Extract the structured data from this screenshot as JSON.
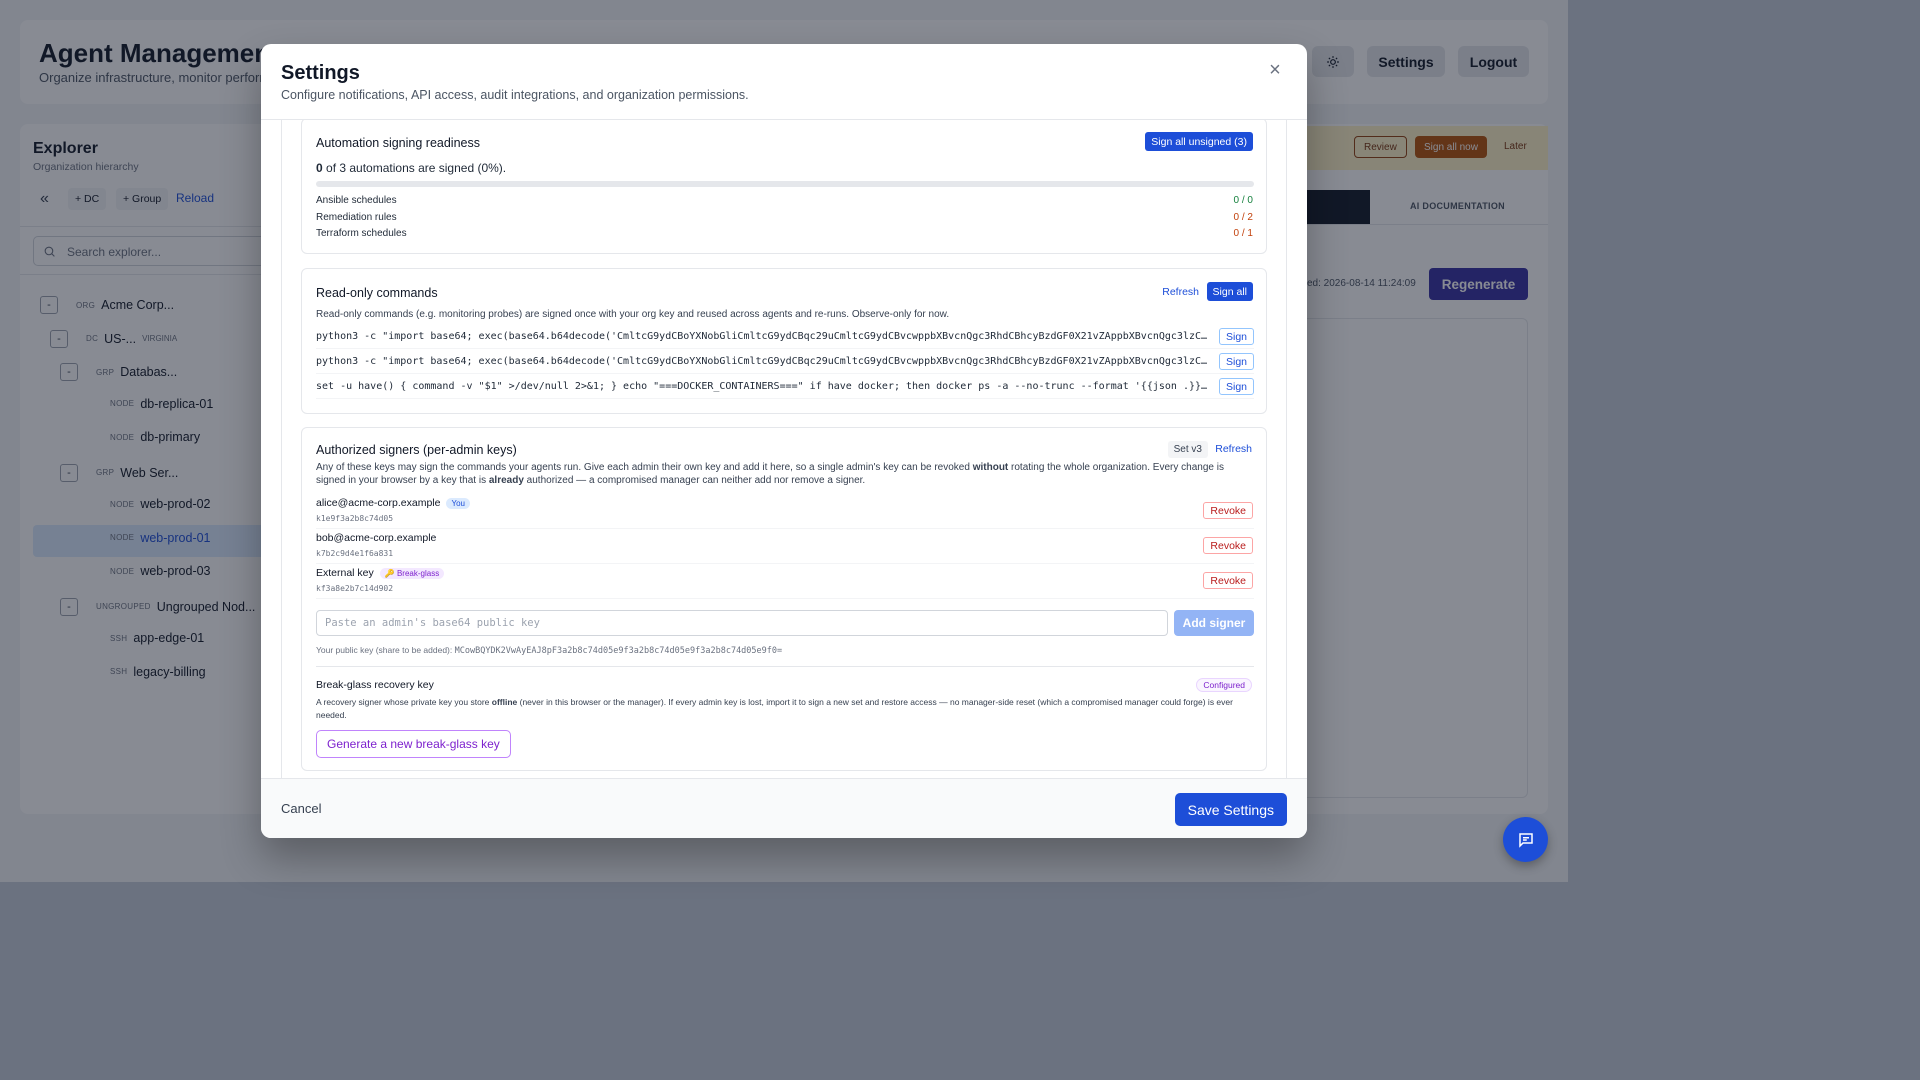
{
  "background": {
    "title": "Agent Managemen",
    "subtitle": "Organize infrastructure, monitor performa",
    "header_buttons": {
      "theme_icon": "sun-icon",
      "settings": "Settings",
      "logout": "Logout"
    },
    "explorer": {
      "title": "Explorer",
      "subtitle": "Organization hierarchy",
      "toolbar": {
        "collapse_icon": "double-chevron-left-icon",
        "add_dc": "+ DC",
        "add_group": "+ Group",
        "reload": "Reload"
      },
      "search_placeholder": "Search explorer...",
      "tree": [
        {
          "toggle": "-",
          "type": "ORG",
          "label": "Acme Corp...",
          "sub": ""
        },
        {
          "toggle": "-",
          "type": "DC",
          "label": "US-...",
          "sub": "VIRGINIA"
        },
        {
          "toggle": "-",
          "type": "GRP",
          "label": "Databas...",
          "sub": ""
        },
        {
          "toggle": "",
          "type": "NODE",
          "label": "db-replica-01",
          "sub": ""
        },
        {
          "toggle": "",
          "type": "NODE",
          "label": "db-primary",
          "sub": ""
        },
        {
          "toggle": "-",
          "type": "GRP",
          "label": "Web Ser...",
          "sub": ""
        },
        {
          "toggle": "",
          "type": "NODE",
          "label": "web-prod-02",
          "sub": ""
        },
        {
          "toggle": "",
          "type": "NODE",
          "label": "web-prod-01",
          "sub": ""
        },
        {
          "toggle": "",
          "type": "NODE",
          "label": "web-prod-03",
          "sub": ""
        },
        {
          "toggle": "-",
          "type": "UNGROUPED",
          "label": "Ungrouped Nod...",
          "sub": ""
        },
        {
          "toggle": "",
          "type": "SSH",
          "label": "app-edge-01",
          "sub": ""
        },
        {
          "toggle": "",
          "type": "SSH",
          "label": "legacy-billing",
          "sub": ""
        }
      ]
    },
    "banner": {
      "review": "Review",
      "sign_all_now": "Sign all now",
      "later": "Later"
    },
    "tabs": {
      "ai_documentation": "AI DOCUMENTATION"
    },
    "generated_text": "ed: 2026-08-14 11:24:09",
    "regenerate": "Regenerate",
    "chat_icon": "chat-icon"
  },
  "modal": {
    "title": "Settings",
    "subtitle": "Configure notifications, API access, audit integrations, and organization permissions.",
    "close_icon": "close-icon",
    "automation": {
      "title": "Automation signing readiness",
      "sign_all_unsigned": "Sign all unsigned (3)",
      "summary_count": "0",
      "summary_text": " of 3 automations are signed (0%).",
      "progress_fraction": 0,
      "rows": [
        {
          "label": "Ansible schedules",
          "value": "0 / 0",
          "color": "#15803d"
        },
        {
          "label": "Remediation rules",
          "value": "0 / 2",
          "color": "#c2410c"
        },
        {
          "label": "Terraform schedules",
          "value": "0 / 1",
          "color": "#c2410c"
        }
      ]
    },
    "readonly": {
      "title": "Read-only commands",
      "refresh": "Refresh",
      "sign_all": "Sign all",
      "description": "Read-only commands (e.g. monitoring probes) are signed once with your org key and reused across agents and re-runs. Observe-only for now.",
      "sign_label": "Sign",
      "commands": [
        "python3 -c \"import base64; exec(base64.b64decode('CmltcG9ydCBoYXNobGliCmltcG9ydCBqc29uCmltcG9ydCBvcwppbXBvcnQgc3RhdCBhcyBzdGF0X21vZAppbXBvcnQgc3lzCgpQ...",
        "python3 -c \"import base64; exec(base64.b64decode('CmltcG9ydCBoYXNobGliCmltcG9ydCBqc29uCmltcG9ydCBvcwppbXBvcnQgc3RhdCBhcyBzdGF0X21vZAppbXBvcnQgc3lzCgpQ...",
        "set -u have() { command -v \"$1\" >/dev/null 2>&1; } echo \"===DOCKER_CONTAINERS===\" if have docker; then docker ps -a --no-trunc --format '{{json .}}' 2..."
      ]
    },
    "signers": {
      "title": "Authorized signers (per-admin keys)",
      "set_version": "Set v3",
      "refresh": "Refresh",
      "description_1": "Any of these keys may sign the commands your agents run. Give each admin their own key and add it here, so a single admin's key can be revoked ",
      "description_bold_1": "without",
      "description_2": " rotating the whole organization. Every change is signed in your browser by a key that is ",
      "description_bold_2": "already",
      "description_3": " authorized — a compromised manager can neither add nor remove a signer.",
      "revoke_label": "Revoke",
      "list": [
        {
          "name": "alice@acme-corp.example",
          "badge": "You",
          "key": "k1e9f3a2b8c74d05"
        },
        {
          "name": "bob@acme-corp.example",
          "badge": "",
          "key": "k7b2c9d4e1f6a831"
        },
        {
          "name": "External key",
          "badge": "🔑 Break-glass",
          "key": "kf3a8e2b7c14d902"
        }
      ],
      "input_placeholder": "Paste an admin's base64 public key",
      "add_signer": "Add signer",
      "public_key_label": "Your public key (share to be added): ",
      "public_key_value": "MCowBQYDK2VwAyEAJ8pF3a2b8c74d05e9f3a2b8c74d05e9f3a2b8c74d05e9f0=",
      "breakglass": {
        "title": "Break-glass recovery key",
        "status": "Configured",
        "description_1": "A recovery signer whose private key you store ",
        "description_bold": "offline",
        "description_2": " (never in this browser or the manager). If every admin key is lost, import it to sign a new set and restore access — no manager-side reset (which a compromised manager could forge) is ever needed.",
        "generate": "Generate a new break-glass key"
      }
    },
    "footer": {
      "cancel": "Cancel",
      "save": "Save Settings"
    }
  }
}
